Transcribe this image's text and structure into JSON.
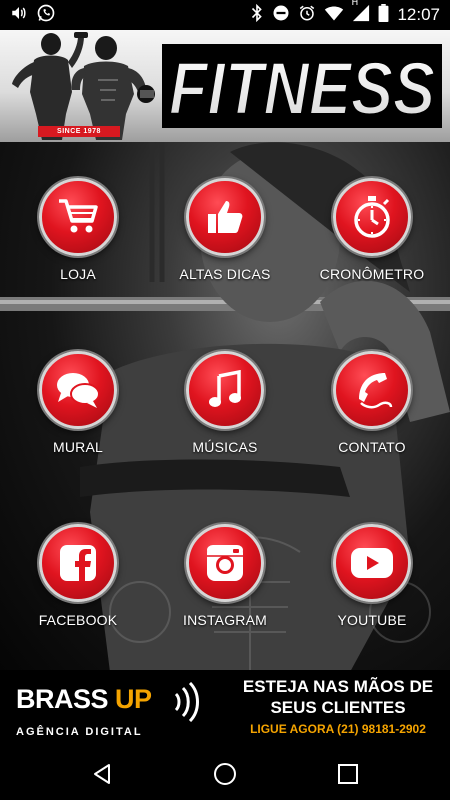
{
  "status_bar": {
    "time": "12:07",
    "left_icons": [
      "volume-icon",
      "whatsapp-icon"
    ],
    "right_icons": [
      "bluetooth-icon",
      "do-not-disturb-icon",
      "alarm-icon",
      "wifi-icon",
      "signal-icon",
      "battery-icon"
    ],
    "signal_letter": "H"
  },
  "header": {
    "title": "FITNESS",
    "since": "SINCE 1978"
  },
  "menu": {
    "items": [
      {
        "label": "LOJA",
        "icon": "shopping-cart-icon"
      },
      {
        "label": "ALTAS DICAS",
        "icon": "thumbs-up-icon"
      },
      {
        "label": "CRONÔMETRO",
        "icon": "stopwatch-icon"
      },
      {
        "label": "MURAL",
        "icon": "chat-bubbles-icon"
      },
      {
        "label": "MÚSICAS",
        "icon": "music-note-icon"
      },
      {
        "label": "CONTATO",
        "icon": "phone-icon"
      },
      {
        "label": "FACEBOOK",
        "icon": "facebook-icon"
      },
      {
        "label": "INSTAGRAM",
        "icon": "instagram-icon"
      },
      {
        "label": "YOUTUBE",
        "icon": "youtube-icon"
      }
    ]
  },
  "ad": {
    "brand_main": "BRASS ",
    "brand_accent": "UP",
    "brand_sub": "AGÊNCIA DIGITAL",
    "headline_1": "ESTEJA NAS MÃOS DE",
    "headline_2": "SEUS CLIENTES",
    "cta": "LIGUE AGORA (21) 98181-2902",
    "accent_color": "#f5a400"
  },
  "nav": {
    "back": "back-icon",
    "home": "home-icon",
    "recents": "recents-icon"
  },
  "colors": {
    "button_red": "#e0141f",
    "badge_red": "#d71920"
  }
}
